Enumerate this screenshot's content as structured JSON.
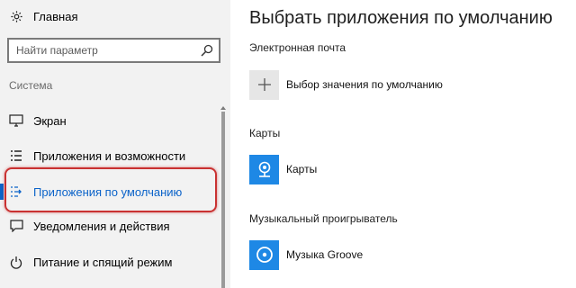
{
  "sidebar": {
    "home_label": "Главная",
    "search_placeholder": "Найти параметр",
    "section_label": "Система",
    "items": [
      {
        "label": "Экран",
        "icon": "monitor-icon"
      },
      {
        "label": "Приложения и возможности",
        "icon": "list-icon"
      },
      {
        "label": "Приложения по умолчанию",
        "icon": "default-apps-icon",
        "active": true
      },
      {
        "label": "Уведомления и действия",
        "icon": "notification-icon"
      },
      {
        "label": "Питание и спящий режим",
        "icon": "power-icon"
      }
    ]
  },
  "main": {
    "title": "Выбрать приложения по умолчанию",
    "categories": [
      {
        "label": "Электронная почта",
        "app_label": "Выбор значения по умолчанию",
        "app_icon": "plus-icon"
      },
      {
        "label": "Карты",
        "app_label": "Карты",
        "app_icon": "maps-icon"
      },
      {
        "label": "Музыкальный проигрыватель",
        "app_label": "Музыка Groove",
        "app_icon": "groove-music-icon"
      }
    ]
  },
  "colors": {
    "accent": "#0b63c9",
    "highlight": "#c93131",
    "tile_blue": "#1e88e5",
    "sidebar_bg": "#f2f2f2"
  }
}
